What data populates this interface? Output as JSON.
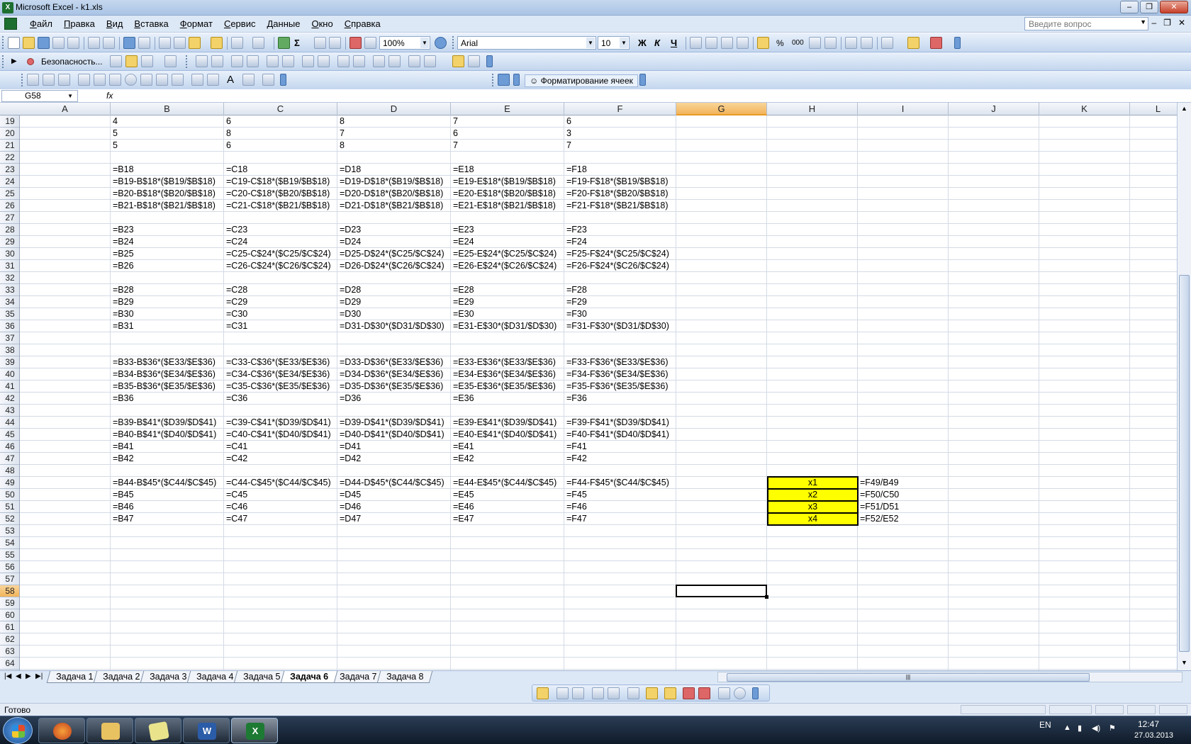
{
  "window": {
    "title": "Microsoft Excel - k1.xls"
  },
  "menu": {
    "items": [
      "Файл",
      "Правка",
      "Вид",
      "Вставка",
      "Формат",
      "Сервис",
      "Данные",
      "Окно",
      "Справка"
    ]
  },
  "help_box": {
    "placeholder": "Введите вопрос"
  },
  "toolbar": {
    "zoom": "100%",
    "font": "Arial",
    "font_size": "10",
    "bold": "Ж",
    "italic": "К",
    "underline": "Ч",
    "percent": "%",
    "thousands": "000"
  },
  "toolbar2": {
    "security_label": "Безопасность..."
  },
  "toolbar3": {
    "format_cells_label": "Форматирование ячеек"
  },
  "formula_bar": {
    "name_box": "G58",
    "fx": "fx",
    "formula": ""
  },
  "columns": [
    "A",
    "B",
    "C",
    "D",
    "E",
    "F",
    "G",
    "H",
    "I",
    "J",
    "K",
    "L"
  ],
  "selected_column": "G",
  "rows": [
    "19",
    "20",
    "21",
    "22",
    "23",
    "24",
    "25",
    "26",
    "27",
    "28",
    "29",
    "30",
    "31",
    "32",
    "33",
    "34",
    "35",
    "36",
    "37",
    "38",
    "39",
    "40",
    "41",
    "42",
    "43",
    "44",
    "45",
    "46",
    "47",
    "48",
    "49",
    "50",
    "51",
    "52",
    "53",
    "54",
    "55",
    "56",
    "57",
    "58",
    "59",
    "60",
    "61",
    "62",
    "63",
    "64"
  ],
  "selected_row": "58",
  "cells": [
    {
      "row": "19",
      "values": [
        "4",
        "6",
        "8",
        "7",
        "6"
      ]
    },
    {
      "row": "20",
      "values": [
        "5",
        "8",
        "7",
        "6",
        "3"
      ]
    },
    {
      "row": "21",
      "values": [
        "5",
        "6",
        "8",
        "7",
        "7"
      ]
    },
    {
      "row": "23",
      "values": [
        "=B18",
        "=C18",
        "=D18",
        "=E18",
        "=F18"
      ]
    },
    {
      "row": "24",
      "values": [
        "=B19-B$18*($B19/$B$18)",
        "=C19-C$18*($B19/$B$18)",
        "=D19-D$18*($B19/$B$18)",
        "=E19-E$18*($B19/$B$18)",
        "=F19-F$18*($B19/$B$18)"
      ]
    },
    {
      "row": "25",
      "values": [
        "=B20-B$18*($B20/$B$18)",
        "=C20-C$18*($B20/$B$18)",
        "=D20-D$18*($B20/$B$18)",
        "=E20-E$18*($B20/$B$18)",
        "=F20-F$18*($B20/$B$18)"
      ]
    },
    {
      "row": "26",
      "values": [
        "=B21-B$18*($B21/$B$18)",
        "=C21-C$18*($B21/$B$18)",
        "=D21-D$18*($B21/$B$18)",
        "=E21-E$18*($B21/$B$18)",
        "=F21-F$18*($B21/$B$18)"
      ]
    },
    {
      "row": "28",
      "values": [
        "=B23",
        "=C23",
        "=D23",
        "=E23",
        "=F23"
      ]
    },
    {
      "row": "29",
      "values": [
        "=B24",
        "=C24",
        "=D24",
        "=E24",
        "=F24"
      ]
    },
    {
      "row": "30",
      "values": [
        "=B25",
        "=C25-C$24*($C25/$C$24)",
        "=D25-D$24*($C25/$C$24)",
        "=E25-E$24*($C25/$C$24)",
        "=F25-F$24*($C25/$C$24)"
      ]
    },
    {
      "row": "31",
      "values": [
        "=B26",
        "=C26-C$24*($C26/$C$24)",
        "=D26-D$24*($C26/$C$24)",
        "=E26-E$24*($C26/$C$24)",
        "=F26-F$24*($C26/$C$24)"
      ]
    },
    {
      "row": "33",
      "values": [
        "=B28",
        "=C28",
        "=D28",
        "=E28",
        "=F28"
      ]
    },
    {
      "row": "34",
      "values": [
        "=B29",
        "=C29",
        "=D29",
        "=E29",
        "=F29"
      ]
    },
    {
      "row": "35",
      "values": [
        "=B30",
        "=C30",
        "=D30",
        "=E30",
        "=F30"
      ]
    },
    {
      "row": "36",
      "values": [
        "=B31",
        "=C31",
        "=D31-D$30*($D31/$D$30)",
        "=E31-E$30*($D31/$D$30)",
        "=F31-F$30*($D31/$D$30)"
      ]
    },
    {
      "row": "39",
      "values": [
        "=B33-B$36*($E33/$E$36)",
        "=C33-C$36*($E33/$E$36)",
        "=D33-D$36*($E33/$E$36)",
        "=E33-E$36*($E33/$E$36)",
        "=F33-F$36*($E33/$E$36)"
      ]
    },
    {
      "row": "40",
      "values": [
        "=B34-B$36*($E34/$E$36)",
        "=C34-C$36*($E34/$E$36)",
        "=D34-D$36*($E34/$E$36)",
        "=E34-E$36*($E34/$E$36)",
        "=F34-F$36*($E34/$E$36)"
      ]
    },
    {
      "row": "41",
      "values": [
        "=B35-B$36*($E35/$E$36)",
        "=C35-C$36*($E35/$E$36)",
        "=D35-D$36*($E35/$E$36)",
        "=E35-E$36*($E35/$E$36)",
        "=F35-F$36*($E35/$E$36)"
      ]
    },
    {
      "row": "42",
      "values": [
        "=B36",
        "=C36",
        "=D36",
        "=E36",
        "=F36"
      ]
    },
    {
      "row": "44",
      "values": [
        "=B39-B$41*($D39/$D$41)",
        "=C39-C$41*($D39/$D$41)",
        "=D39-D$41*($D39/$D$41)",
        "=E39-E$41*($D39/$D$41)",
        "=F39-F$41*($D39/$D$41)"
      ]
    },
    {
      "row": "45",
      "values": [
        "=B40-B$41*($D40/$D$41)",
        "=C40-C$41*($D40/$D$41)",
        "=D40-D$41*($D40/$D$41)",
        "=E40-E$41*($D40/$D$41)",
        "=F40-F$41*($D40/$D$41)"
      ]
    },
    {
      "row": "46",
      "values": [
        "=B41",
        "=C41",
        "=D41",
        "=E41",
        "=F41"
      ]
    },
    {
      "row": "47",
      "values": [
        "=B42",
        "=C42",
        "=D42",
        "=E42",
        "=F42"
      ]
    },
    {
      "row": "49",
      "values": [
        "=B44-B$45*($C44/$C$45)",
        "=C44-C$45*($C44/$C$45)",
        "=D44-D$45*($C44/$C$45)",
        "=E44-E$45*($C44/$C$45)",
        "=F44-F$45*($C44/$C$45)"
      ]
    },
    {
      "row": "50",
      "values": [
        "=B45",
        "=C45",
        "=D45",
        "=E45",
        "=F45"
      ]
    },
    {
      "row": "51",
      "values": [
        "=B46",
        "=C46",
        "=D46",
        "=E46",
        "=F46"
      ]
    },
    {
      "row": "52",
      "values": [
        "=B47",
        "=C47",
        "=D47",
        "=E47",
        "=F47"
      ]
    }
  ],
  "solution": [
    {
      "row": "49",
      "label": "x1",
      "formula": "=F49/B49"
    },
    {
      "row": "50",
      "label": "x2",
      "formula": "=F50/C50"
    },
    {
      "row": "51",
      "label": "x3",
      "formula": "=F51/D51"
    },
    {
      "row": "52",
      "label": "x4",
      "formula": "=F52/E52"
    }
  ],
  "highlight_color": "#ffff00",
  "sheet_tabs": [
    "Задача 1",
    "Задача 2",
    "Задача 3",
    "Задача 4",
    "Задача 5",
    "Задача 6",
    "Задача 7",
    "Задача 8"
  ],
  "active_tab": "Задача 6",
  "status": {
    "text": "Готово"
  },
  "taskbar": {
    "lang": "EN",
    "time": "12:47",
    "date": "27.03.2013"
  }
}
